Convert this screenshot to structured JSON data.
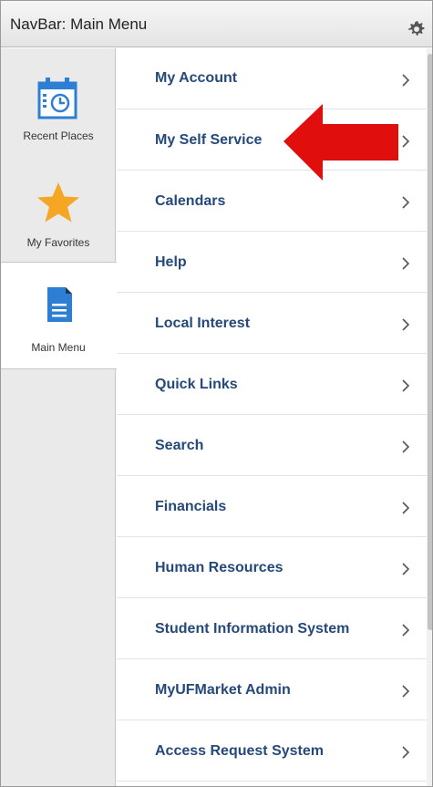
{
  "header": {
    "title": "NavBar: Main Menu"
  },
  "side_tabs": [
    {
      "label": "Recent Places",
      "icon": "calendar-clock-icon"
    },
    {
      "label": "My Favorites",
      "icon": "star-icon"
    },
    {
      "label": "Main Menu",
      "icon": "document-icon",
      "active": true
    }
  ],
  "menu": {
    "items": [
      {
        "label": "My Account"
      },
      {
        "label": "My Self Service"
      },
      {
        "label": "Calendars"
      },
      {
        "label": "Help"
      },
      {
        "label": "Local Interest"
      },
      {
        "label": "Quick Links"
      },
      {
        "label": "Search"
      },
      {
        "label": "Financials"
      },
      {
        "label": "Human Resources"
      },
      {
        "label": "Student Information System"
      },
      {
        "label": "MyUFMarket Admin"
      },
      {
        "label": "Access Request System"
      }
    ]
  },
  "colors": {
    "menu_text": "#24497a",
    "icon_blue": "#2d7fd3",
    "star": "#f5a623",
    "arrow": "#e10e0e"
  }
}
